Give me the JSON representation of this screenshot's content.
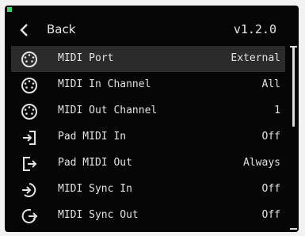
{
  "header": {
    "back_label": "Back",
    "version": "v1.2.0",
    "back_icon": "chevron-left-icon"
  },
  "menu": {
    "items": [
      {
        "label": "MIDI Port",
        "value": "External",
        "icon": "midi-din-icon",
        "selected": true
      },
      {
        "label": "MIDI In Channel",
        "value": "All",
        "icon": "midi-din-icon"
      },
      {
        "label": "MIDI Out Channel",
        "value": "1",
        "icon": "midi-din-icon"
      },
      {
        "label": "Pad MIDI In",
        "value": "Off",
        "icon": "arrow-in-icon"
      },
      {
        "label": "Pad MIDI Out",
        "value": "Always",
        "icon": "arrow-out-icon"
      },
      {
        "label": "MIDI Sync In",
        "value": "Off",
        "icon": "sync-in-icon"
      },
      {
        "label": "MIDI Sync Out",
        "value": "Off",
        "icon": "sync-out-icon"
      }
    ]
  },
  "colors": {
    "accent": "#3fd466",
    "background": "#050505",
    "selected_row": "#2b2b2b",
    "text": "#e2e2e2"
  }
}
